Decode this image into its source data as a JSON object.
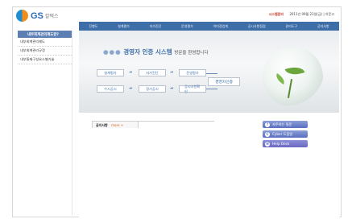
{
  "logo": {
    "brand": "GS",
    "sub": "칼텍스"
  },
  "userbar": {
    "user": "시스템관리",
    "date": "2011년 09월 23일(금) | 아웃고"
  },
  "topnav": [
    "진행도",
    "설계평가",
    "자가진단",
    "운영평가",
    "이미경업계",
    "공시사항점점",
    "관리도구",
    "공지사항"
  ],
  "sidebar": {
    "title": "내부회계관리제도란?",
    "items": [
      "내부회계관리제도",
      "내부회계관리규정",
      "내부통제구성요소별기술"
    ]
  },
  "banner": {
    "dots": "●●●",
    "title": "경영자 인증 시스템",
    "sub": "방문을 환영합니다",
    "flow": {
      "design": "설계평가",
      "self": "자가진단",
      "operate": "운영평가",
      "mgmt": "경영자인증",
      "disclose": "수시공시",
      "period": "정기공시",
      "confirm": "공시사항확인"
    }
  },
  "notice": {
    "tab": "공지사항",
    "more": "more +"
  },
  "quick": [
    {
      "icon": "?",
      "label": "자주하는 질문"
    },
    {
      "icon": "C",
      "label": "Cyber 도움말"
    },
    {
      "icon": "H",
      "label": "Help Desk"
    }
  ],
  "colors": {
    "nav": "#3e6ea8",
    "sidebar_title": "#5c7fb4",
    "accent": "#3f6fa6",
    "leaf": "#6aa63c"
  }
}
